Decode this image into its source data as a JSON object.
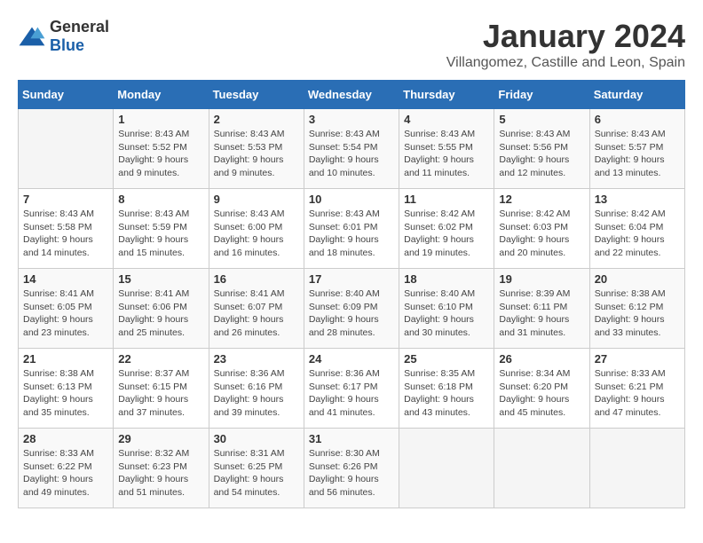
{
  "logo": {
    "general": "General",
    "blue": "Blue"
  },
  "title": "January 2024",
  "subtitle": "Villangomez, Castille and Leon, Spain",
  "headers": [
    "Sunday",
    "Monday",
    "Tuesday",
    "Wednesday",
    "Thursday",
    "Friday",
    "Saturday"
  ],
  "weeks": [
    [
      {
        "day": "",
        "lines": []
      },
      {
        "day": "1",
        "lines": [
          "Sunrise: 8:43 AM",
          "Sunset: 5:52 PM",
          "Daylight: 9 hours",
          "and 9 minutes."
        ]
      },
      {
        "day": "2",
        "lines": [
          "Sunrise: 8:43 AM",
          "Sunset: 5:53 PM",
          "Daylight: 9 hours",
          "and 9 minutes."
        ]
      },
      {
        "day": "3",
        "lines": [
          "Sunrise: 8:43 AM",
          "Sunset: 5:54 PM",
          "Daylight: 9 hours",
          "and 10 minutes."
        ]
      },
      {
        "day": "4",
        "lines": [
          "Sunrise: 8:43 AM",
          "Sunset: 5:55 PM",
          "Daylight: 9 hours",
          "and 11 minutes."
        ]
      },
      {
        "day": "5",
        "lines": [
          "Sunrise: 8:43 AM",
          "Sunset: 5:56 PM",
          "Daylight: 9 hours",
          "and 12 minutes."
        ]
      },
      {
        "day": "6",
        "lines": [
          "Sunrise: 8:43 AM",
          "Sunset: 5:57 PM",
          "Daylight: 9 hours",
          "and 13 minutes."
        ]
      }
    ],
    [
      {
        "day": "7",
        "lines": [
          "Sunrise: 8:43 AM",
          "Sunset: 5:58 PM",
          "Daylight: 9 hours",
          "and 14 minutes."
        ]
      },
      {
        "day": "8",
        "lines": [
          "Sunrise: 8:43 AM",
          "Sunset: 5:59 PM",
          "Daylight: 9 hours",
          "and 15 minutes."
        ]
      },
      {
        "day": "9",
        "lines": [
          "Sunrise: 8:43 AM",
          "Sunset: 6:00 PM",
          "Daylight: 9 hours",
          "and 16 minutes."
        ]
      },
      {
        "day": "10",
        "lines": [
          "Sunrise: 8:43 AM",
          "Sunset: 6:01 PM",
          "Daylight: 9 hours",
          "and 18 minutes."
        ]
      },
      {
        "day": "11",
        "lines": [
          "Sunrise: 8:42 AM",
          "Sunset: 6:02 PM",
          "Daylight: 9 hours",
          "and 19 minutes."
        ]
      },
      {
        "day": "12",
        "lines": [
          "Sunrise: 8:42 AM",
          "Sunset: 6:03 PM",
          "Daylight: 9 hours",
          "and 20 minutes."
        ]
      },
      {
        "day": "13",
        "lines": [
          "Sunrise: 8:42 AM",
          "Sunset: 6:04 PM",
          "Daylight: 9 hours",
          "and 22 minutes."
        ]
      }
    ],
    [
      {
        "day": "14",
        "lines": [
          "Sunrise: 8:41 AM",
          "Sunset: 6:05 PM",
          "Daylight: 9 hours",
          "and 23 minutes."
        ]
      },
      {
        "day": "15",
        "lines": [
          "Sunrise: 8:41 AM",
          "Sunset: 6:06 PM",
          "Daylight: 9 hours",
          "and 25 minutes."
        ]
      },
      {
        "day": "16",
        "lines": [
          "Sunrise: 8:41 AM",
          "Sunset: 6:07 PM",
          "Daylight: 9 hours",
          "and 26 minutes."
        ]
      },
      {
        "day": "17",
        "lines": [
          "Sunrise: 8:40 AM",
          "Sunset: 6:09 PM",
          "Daylight: 9 hours",
          "and 28 minutes."
        ]
      },
      {
        "day": "18",
        "lines": [
          "Sunrise: 8:40 AM",
          "Sunset: 6:10 PM",
          "Daylight: 9 hours",
          "and 30 minutes."
        ]
      },
      {
        "day": "19",
        "lines": [
          "Sunrise: 8:39 AM",
          "Sunset: 6:11 PM",
          "Daylight: 9 hours",
          "and 31 minutes."
        ]
      },
      {
        "day": "20",
        "lines": [
          "Sunrise: 8:38 AM",
          "Sunset: 6:12 PM",
          "Daylight: 9 hours",
          "and 33 minutes."
        ]
      }
    ],
    [
      {
        "day": "21",
        "lines": [
          "Sunrise: 8:38 AM",
          "Sunset: 6:13 PM",
          "Daylight: 9 hours",
          "and 35 minutes."
        ]
      },
      {
        "day": "22",
        "lines": [
          "Sunrise: 8:37 AM",
          "Sunset: 6:15 PM",
          "Daylight: 9 hours",
          "and 37 minutes."
        ]
      },
      {
        "day": "23",
        "lines": [
          "Sunrise: 8:36 AM",
          "Sunset: 6:16 PM",
          "Daylight: 9 hours",
          "and 39 minutes."
        ]
      },
      {
        "day": "24",
        "lines": [
          "Sunrise: 8:36 AM",
          "Sunset: 6:17 PM",
          "Daylight: 9 hours",
          "and 41 minutes."
        ]
      },
      {
        "day": "25",
        "lines": [
          "Sunrise: 8:35 AM",
          "Sunset: 6:18 PM",
          "Daylight: 9 hours",
          "and 43 minutes."
        ]
      },
      {
        "day": "26",
        "lines": [
          "Sunrise: 8:34 AM",
          "Sunset: 6:20 PM",
          "Daylight: 9 hours",
          "and 45 minutes."
        ]
      },
      {
        "day": "27",
        "lines": [
          "Sunrise: 8:33 AM",
          "Sunset: 6:21 PM",
          "Daylight: 9 hours",
          "and 47 minutes."
        ]
      }
    ],
    [
      {
        "day": "28",
        "lines": [
          "Sunrise: 8:33 AM",
          "Sunset: 6:22 PM",
          "Daylight: 9 hours",
          "and 49 minutes."
        ]
      },
      {
        "day": "29",
        "lines": [
          "Sunrise: 8:32 AM",
          "Sunset: 6:23 PM",
          "Daylight: 9 hours",
          "and 51 minutes."
        ]
      },
      {
        "day": "30",
        "lines": [
          "Sunrise: 8:31 AM",
          "Sunset: 6:25 PM",
          "Daylight: 9 hours",
          "and 54 minutes."
        ]
      },
      {
        "day": "31",
        "lines": [
          "Sunrise: 8:30 AM",
          "Sunset: 6:26 PM",
          "Daylight: 9 hours",
          "and 56 minutes."
        ]
      },
      {
        "day": "",
        "lines": []
      },
      {
        "day": "",
        "lines": []
      },
      {
        "day": "",
        "lines": []
      }
    ]
  ]
}
